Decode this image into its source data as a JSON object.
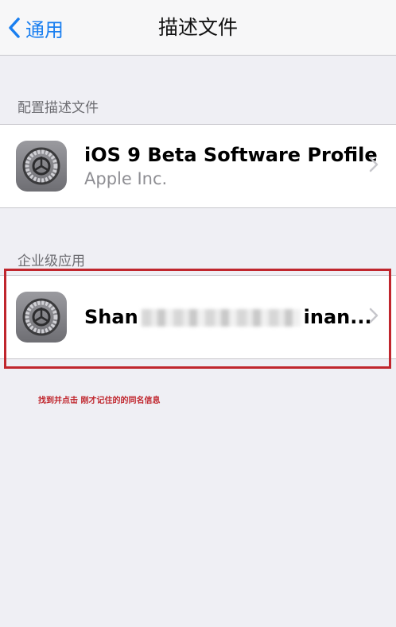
{
  "nav": {
    "back_label": "通用",
    "title": "描述文件"
  },
  "sections": [
    {
      "header": "配置描述文件",
      "row": {
        "title": "iOS 9 Beta Software Profile",
        "subtitle": "Apple Inc."
      }
    },
    {
      "header": "企业级应用",
      "row": {
        "title_prefix": "Shan",
        "title_suffix": "inan..."
      }
    }
  ],
  "annotation": "找到并点击 刚才记住的的同名信息",
  "colors": {
    "accent": "#1a7ff0",
    "highlight": "#c0262d",
    "background": "#efeff4"
  },
  "icons": [
    "chevron-left-icon",
    "settings-gear-icon",
    "chevron-right-icon"
  ]
}
